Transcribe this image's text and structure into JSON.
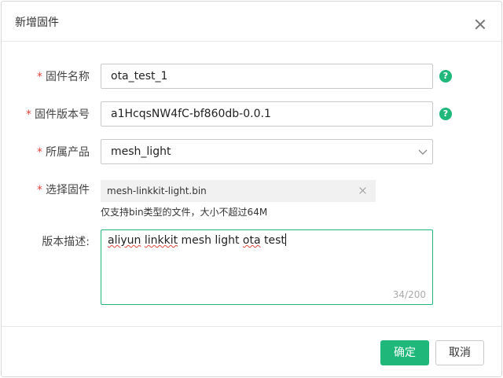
{
  "dialog": {
    "title": "新增固件",
    "fields": {
      "name": {
        "label": "固件名称",
        "value": "ota_test_1",
        "required": true
      },
      "version": {
        "label": "固件版本号",
        "value": "a1HcqsNW4fC-bf860db-0.0.1",
        "required": true
      },
      "product": {
        "label": "所属产品",
        "value": "mesh_light",
        "required": true
      },
      "file": {
        "label": "选择固件",
        "file_name": "mesh-linkkit-light.bin",
        "hint": "仅支持bin类型的文件，大小不超过64M",
        "required": true
      },
      "description": {
        "label": "版本描述:",
        "words": [
          "aliyun",
          " ",
          "linkkit",
          " mesh light ",
          "ota",
          " test"
        ],
        "counter": "34/200"
      }
    },
    "required_mark": "*",
    "help_glyph": "?",
    "buttons": {
      "ok": "确定",
      "cancel": "取消"
    }
  },
  "colors": {
    "primary": "#1fb87a",
    "required": "#e0483a"
  }
}
